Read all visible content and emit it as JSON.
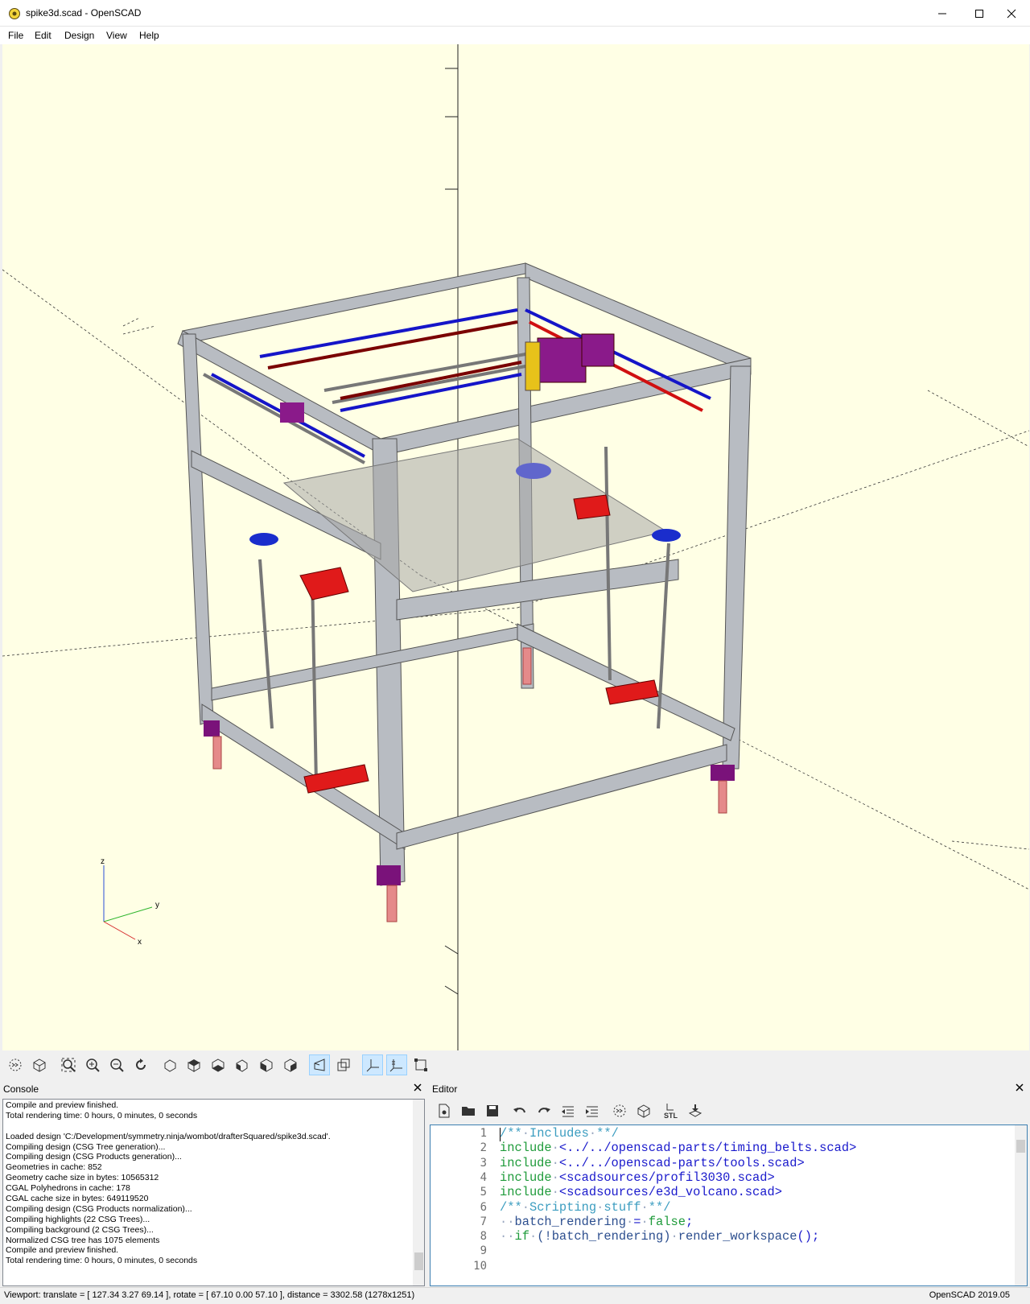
{
  "window": {
    "title": "spike3d.scad - OpenSCAD",
    "minimize": "—",
    "maximize": "☐",
    "close": "✕"
  },
  "menu": [
    "File",
    "Edit",
    "Design",
    "View",
    "Help"
  ],
  "viewport": {
    "background": "#ffffe5",
    "axis_labels": {
      "z": "z",
      "y": "y",
      "x": "x"
    }
  },
  "toolbar_3d": {
    "icons": [
      "preview-icon",
      "render-icon",
      "view-all-icon",
      "zoom-in-icon",
      "zoom-out-icon",
      "reset-view-icon",
      "view-right-icon",
      "view-top-icon",
      "view-bottom-icon",
      "view-left-icon",
      "view-front-icon",
      "view-back-icon",
      "perspective-icon",
      "orthogonal-icon",
      "show-axes-icon",
      "show-scale-markers-icon",
      "show-edges-icon"
    ]
  },
  "console": {
    "title": "Console",
    "lines": [
      "Compile and preview finished.",
      "Total rendering time: 0 hours, 0 minutes, 0 seconds",
      "",
      "Loaded design 'C:/Development/symmetry.ninja/wombot/drafterSquared/spike3d.scad'.",
      "Compiling design (CSG Tree generation)...",
      "Compiling design (CSG Products generation)...",
      "Geometries in cache: 852",
      "Geometry cache size in bytes: 10565312",
      "CGAL Polyhedrons in cache: 178",
      "CGAL cache size in bytes: 649119520",
      "Compiling design (CSG Products normalization)...",
      "Compiling highlights (22 CSG Trees)...",
      "Compiling background (2 CSG Trees)...",
      "Normalized CSG tree has 1075 elements",
      "Compile and preview finished.",
      "Total rendering time: 0 hours, 0 minutes, 0 seconds"
    ]
  },
  "editor": {
    "title": "Editor",
    "toolbar_icons": [
      "new-file-icon",
      "open-file-icon",
      "save-icon",
      "undo-icon",
      "redo-icon",
      "unindent-icon",
      "indent-icon",
      "preview-icon",
      "render-icon",
      "export-stl-icon",
      "send-to-3d-print-icon"
    ],
    "stl_label": "STL",
    "line_numbers": [
      "1",
      "2",
      "3",
      "4",
      "5",
      "6",
      "7",
      "8",
      "9",
      "10"
    ],
    "lines": [
      [
        {
          "t": "/**",
          "c": "c-cmt"
        },
        {
          "t": "·",
          "c": "c-ws"
        },
        {
          "t": "Includes",
          "c": "c-cmt"
        },
        {
          "t": "·",
          "c": "c-ws"
        },
        {
          "t": "**/",
          "c": "c-cmt"
        }
      ],
      [
        {
          "t": "include",
          "c": "c-kw"
        },
        {
          "t": "·",
          "c": "c-ws"
        },
        {
          "t": "<../../openscad-parts/timing_belts.scad>",
          "c": "c-str"
        }
      ],
      [
        {
          "t": "include",
          "c": "c-kw"
        },
        {
          "t": "·",
          "c": "c-ws"
        },
        {
          "t": "<../../openscad-parts/tools.scad>",
          "c": "c-str"
        }
      ],
      [
        {
          "t": "include",
          "c": "c-kw"
        },
        {
          "t": "·",
          "c": "c-ws"
        },
        {
          "t": "<scadsources/profil3030.scad>",
          "c": "c-str"
        }
      ],
      [
        {
          "t": "include",
          "c": "c-kw"
        },
        {
          "t": "·",
          "c": "c-ws"
        },
        {
          "t": "<scadsources/e3d_volcano.scad>",
          "c": "c-str"
        }
      ],
      [
        {
          "t": "/**",
          "c": "c-cmt"
        },
        {
          "t": "·",
          "c": "c-ws"
        },
        {
          "t": "Scripting",
          "c": "c-cmt"
        },
        {
          "t": "·",
          "c": "c-ws"
        },
        {
          "t": "stuff",
          "c": "c-cmt"
        },
        {
          "t": "·",
          "c": "c-ws"
        },
        {
          "t": "**/",
          "c": "c-cmt"
        }
      ],
      [
        {
          "t": "··",
          "c": "c-ws"
        },
        {
          "t": "batch_rendering",
          "c": "c-id"
        },
        {
          "t": "·",
          "c": "c-ws"
        },
        {
          "t": "=",
          "c": "c-op"
        },
        {
          "t": "·",
          "c": "c-ws"
        },
        {
          "t": "false",
          "c": "c-kw"
        },
        {
          "t": ";",
          "c": "c-op"
        }
      ],
      [
        {
          "t": "··",
          "c": "c-ws"
        },
        {
          "t": "if",
          "c": "c-kw"
        },
        {
          "t": "·",
          "c": "c-ws"
        },
        {
          "t": "(!batch_rendering)",
          "c": "c-id"
        },
        {
          "t": "·",
          "c": "c-ws"
        },
        {
          "t": "render_workspace",
          "c": "c-id"
        },
        {
          "t": "();",
          "c": "c-op"
        }
      ],
      [],
      []
    ]
  },
  "statusbar": {
    "viewport_info": "Viewport: translate = [ 127.34 3.27 69.14 ], rotate = [ 67.10 0.00 57.10 ], distance = 3302.58 (1278x1251)",
    "version": "OpenSCAD 2019.05"
  }
}
